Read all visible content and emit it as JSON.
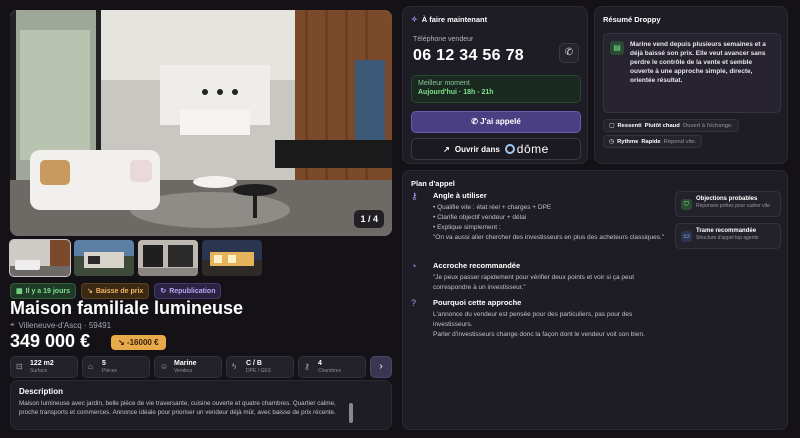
{
  "listing": {
    "image_counter": "1 / 4",
    "tags": [
      {
        "label": "Il y a 19 jours",
        "icon": "calendar-icon"
      },
      {
        "label": "Baisse de prix",
        "icon": "trend-down-icon"
      },
      {
        "label": "Republication",
        "icon": "refresh-icon"
      }
    ],
    "title": "Maison familiale lumineuse",
    "location": "Villeneuve-d'Ascq · 59491",
    "price": "349 000 €",
    "price_drop": "-16000 €",
    "specs": [
      {
        "value": "122 m2",
        "label": "Surface",
        "icon": "ruler-icon"
      },
      {
        "value": "5",
        "label": "Pièces",
        "icon": "rooms-icon"
      },
      {
        "value": "Marine",
        "label": "Vendeur",
        "icon": "user-icon"
      },
      {
        "value": "C / B",
        "label": "DPE / GES",
        "icon": "energy-icon"
      },
      {
        "value": "4",
        "label": "Chambres",
        "icon": "key-icon"
      }
    ],
    "description_title": "Description",
    "description": "Maison lumineuse avec jardin, belle pièce de vie traversante, cuisine ouverte et quatre chambres. Quartier calme, proche transports et commerces. Annonce idéale pour prioriser un vendeur déjà mûr, avec baisse de prix récente."
  },
  "action": {
    "title": "À faire maintenant",
    "phone_label": "Téléphone vendeur",
    "phone": "06 12 34 56 78",
    "best_moment_label": "Meilleur moment",
    "best_moment_value": "Aujourd'hui · 18h - 21h",
    "called_button": "J'ai appelé",
    "open_in_label": "Ouvrir dans",
    "open_in_brand": "dōme"
  },
  "summary": {
    "title": "Résumé Droppy",
    "text": "Marine vend depuis plusieurs semaines et a déjà baissé son prix. Elle veut avancer sans perdre le contrôle de la vente et semble ouverte à une approche simple, directe, orientée résultat.",
    "chips": [
      {
        "label": "Ressenti",
        "value": "Plutôt chaud",
        "note": "Ouvert à l'échange."
      },
      {
        "label": "Rythme",
        "value": "Rapide",
        "note": "Répond vite."
      }
    ]
  },
  "plan": {
    "title": "Plan d'appel",
    "sections": [
      {
        "title": "Angle à utiliser",
        "lines": [
          "• Qualifie vite : état réel + charges + DPE",
          "• Clarifie objectif vendeur + délai",
          "• Explique simplement :",
          "\"On va aussi aller chercher des investisseurs en plus des acheteurs classiques.\""
        ]
      },
      {
        "title": "Accroche recommandée",
        "lines": [
          "\"Je peux passer rapidement pour vérifier deux points et voir si ça peut correspondre à un investisseur.\""
        ]
      },
      {
        "title": "Pourquoi cette approche",
        "lines": [
          "L'annonce du vendeur est pensée pour des particuliers, pas pour des investisseurs.",
          "Parler d'investisseurs change donc la façon dont le vendeur voit son bien."
        ]
      }
    ],
    "cards": [
      {
        "title": "Objections probables",
        "subtitle": "Réponses prêtes pour cadrer vite"
      },
      {
        "title": "Trame recommandée",
        "subtitle": "Structure d'appel top agents"
      }
    ]
  }
}
